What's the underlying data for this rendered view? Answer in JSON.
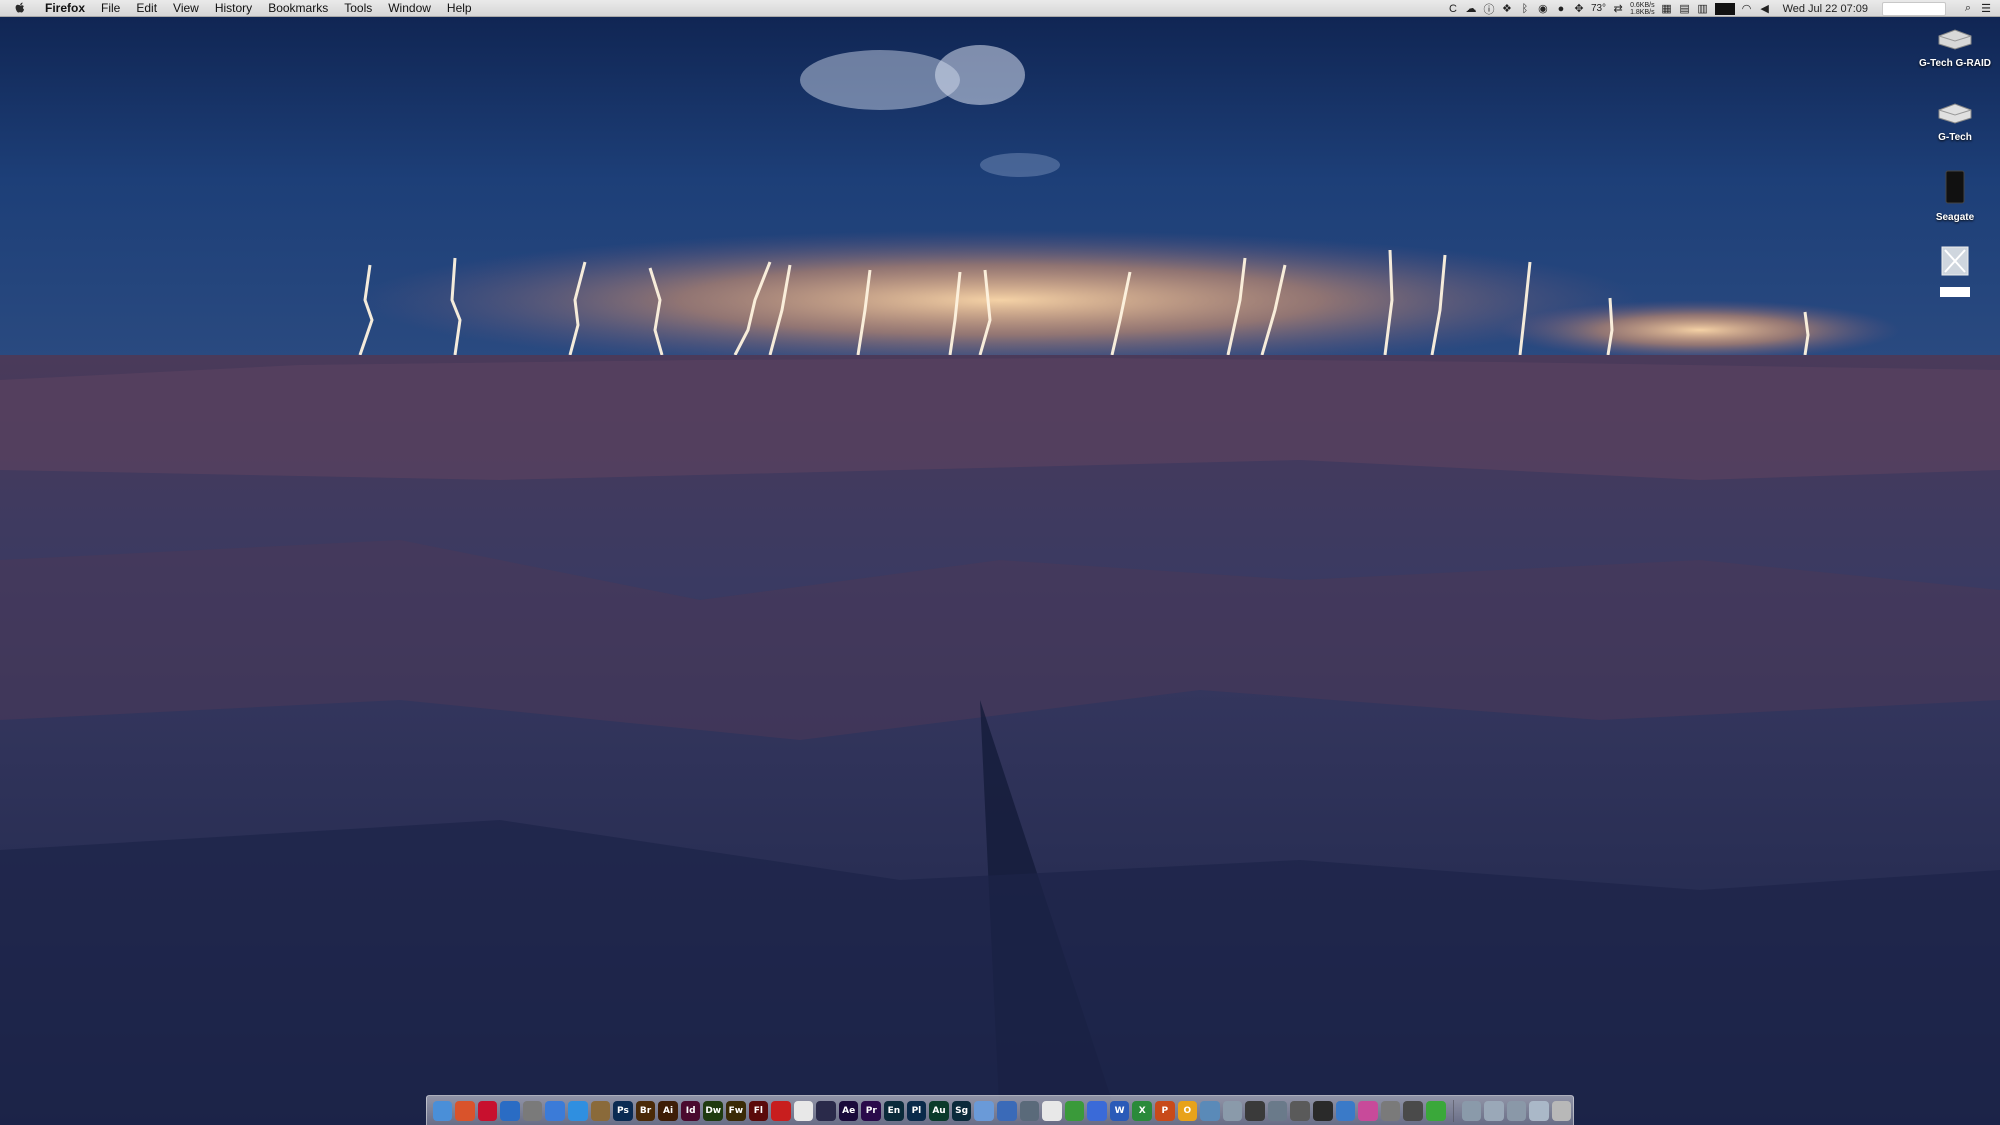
{
  "menubar": {
    "app_name": "Firefox",
    "items": [
      "File",
      "Edit",
      "View",
      "History",
      "Bookmarks",
      "Tools",
      "Window",
      "Help"
    ],
    "status": {
      "temperature": "73°",
      "net_up": "0.6KB/s",
      "net_down": "1.8KB/s",
      "clock": "Wed Jul 22  07:09"
    }
  },
  "desktop": {
    "icons": [
      {
        "label": "G-Tech G-RAID",
        "icon": "external-drive-icon"
      },
      {
        "label": "G-Tech",
        "icon": "external-drive-icon"
      },
      {
        "label": "Seagate",
        "icon": "black-drive-icon"
      },
      {
        "label": "",
        "icon": "file-thumbnail-icon"
      }
    ]
  },
  "dock": {
    "apps": [
      {
        "icon": "finder-icon",
        "glyph": "",
        "color": "#4a8fd8"
      },
      {
        "icon": "firefox-icon",
        "glyph": "",
        "color": "#d9532b"
      },
      {
        "icon": "mail-app-icon",
        "glyph": "",
        "color": "#c8102e"
      },
      {
        "icon": "1password-icon",
        "glyph": "",
        "color": "#2a6cc4"
      },
      {
        "icon": "screenshot-icon",
        "glyph": "",
        "color": "#7a7a7a"
      },
      {
        "icon": "search-app-icon",
        "glyph": "",
        "color": "#3b7bd8"
      },
      {
        "icon": "safari-icon",
        "glyph": "",
        "color": "#2f8fe0"
      },
      {
        "icon": "archive-icon",
        "glyph": "",
        "color": "#8a6a3a"
      },
      {
        "icon": "photoshop-icon",
        "glyph": "Ps",
        "color": "#0a2a52"
      },
      {
        "icon": "bridge-icon",
        "glyph": "Br",
        "color": "#4a2a08"
      },
      {
        "icon": "illustrator-icon",
        "glyph": "Ai",
        "color": "#3d1d06"
      },
      {
        "icon": "indesign-icon",
        "glyph": "Id",
        "color": "#4a0a2e"
      },
      {
        "icon": "dreamweaver-icon",
        "glyph": "Dw",
        "color": "#1f3a10"
      },
      {
        "icon": "fireworks-icon",
        "glyph": "Fw",
        "color": "#3a2a06"
      },
      {
        "icon": "flash-icon",
        "glyph": "Fl",
        "color": "#5a0a0a"
      },
      {
        "icon": "acrobat-icon",
        "glyph": "",
        "color": "#c81e1e"
      },
      {
        "icon": "pdf-icon",
        "glyph": "",
        "color": "#e8e8e8"
      },
      {
        "icon": "media-encoder-icon",
        "glyph": "",
        "color": "#2a2a4a"
      },
      {
        "icon": "after-effects-icon",
        "glyph": "Ae",
        "color": "#1a0a3a"
      },
      {
        "icon": "premiere-icon",
        "glyph": "Pr",
        "color": "#2a0a4a"
      },
      {
        "icon": "encore-icon",
        "glyph": "En",
        "color": "#0a2a3a"
      },
      {
        "icon": "prelude-icon",
        "glyph": "Pl",
        "color": "#0a2a4a"
      },
      {
        "icon": "audition-icon",
        "glyph": "Au",
        "color": "#0a3a2a"
      },
      {
        "icon": "speedgrade-icon",
        "glyph": "Sg",
        "color": "#0a2a3a"
      },
      {
        "icon": "preview-icon",
        "glyph": "",
        "color": "#6a9ad8"
      },
      {
        "icon": "cloud-app-icon",
        "glyph": "",
        "color": "#3a6ab8"
      },
      {
        "icon": "disk-utility-icon",
        "glyph": "",
        "color": "#5a6a7a"
      },
      {
        "icon": "textedit-icon",
        "glyph": "",
        "color": "#e8e8e8"
      },
      {
        "icon": "numbers-icon",
        "glyph": "",
        "color": "#3a9a3a"
      },
      {
        "icon": "keynote-icon",
        "glyph": "",
        "color": "#3a6ad8"
      },
      {
        "icon": "word-icon",
        "glyph": "W",
        "color": "#2a5ab8"
      },
      {
        "icon": "excel-icon",
        "glyph": "X",
        "color": "#2a8a3a"
      },
      {
        "icon": "powerpoint-icon",
        "glyph": "P",
        "color": "#c84a1a"
      },
      {
        "icon": "outlook-icon",
        "glyph": "O",
        "color": "#e8a21a"
      },
      {
        "icon": "folder-icon",
        "glyph": "",
        "color": "#5a8ab8"
      },
      {
        "icon": "stack-icon",
        "glyph": "",
        "color": "#8a9aaa"
      },
      {
        "icon": "calculator-icon",
        "glyph": "",
        "color": "#3a3a3a"
      },
      {
        "icon": "app-store-icon",
        "glyph": "",
        "color": "#6a7a8a"
      },
      {
        "icon": "utility-icon",
        "glyph": "",
        "color": "#5a5a5a"
      },
      {
        "icon": "terminal-icon",
        "glyph": "",
        "color": "#2a2a2a"
      },
      {
        "icon": "network-icon",
        "glyph": "",
        "color": "#3a7ac8"
      },
      {
        "icon": "itunes-icon",
        "glyph": "",
        "color": "#c84a9a"
      },
      {
        "icon": "clock-app-icon",
        "glyph": "",
        "color": "#7a7a7a"
      },
      {
        "icon": "sync-icon",
        "glyph": "",
        "color": "#4a4a4a"
      },
      {
        "icon": "messages-icon",
        "glyph": "",
        "color": "#3aa83a"
      }
    ],
    "stacks": [
      {
        "icon": "documents-stack-icon",
        "color": "#8a9aaa"
      },
      {
        "icon": "downloads-stack-icon",
        "color": "#9aa8b8"
      },
      {
        "icon": "applications-stack-icon",
        "color": "#8a98a8"
      },
      {
        "icon": "desktop-stack-icon",
        "color": "#aab8c8"
      },
      {
        "icon": "trash-icon",
        "color": "#b8b8b8"
      }
    ]
  }
}
